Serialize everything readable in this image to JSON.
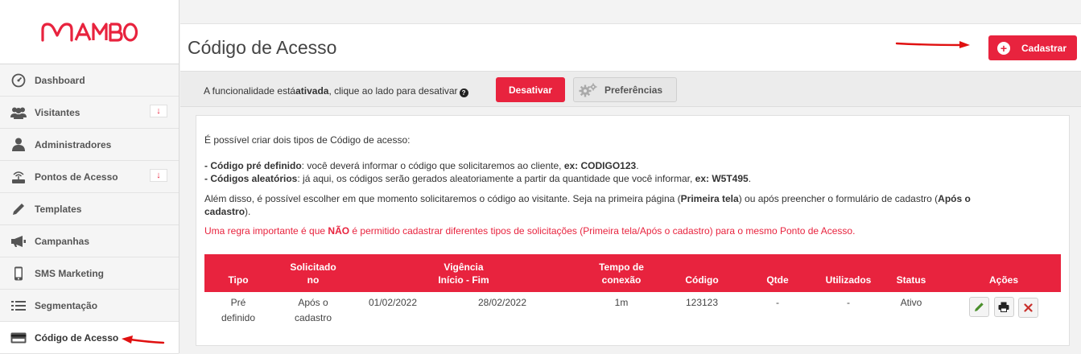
{
  "brand": {
    "logo_text": "MAMBO",
    "accent": "#e8233e"
  },
  "sidebar": {
    "items": [
      {
        "label": "Dashboard",
        "icon": "dashboard-gauge-icon"
      },
      {
        "label": "Visitantes",
        "icon": "users-icon",
        "badge": "↓"
      },
      {
        "label": "Administradores",
        "icon": "user-icon"
      },
      {
        "label": "Pontos de Acesso",
        "icon": "wifi-router-icon",
        "badge": "↓"
      },
      {
        "label": "Templates",
        "icon": "pencil-icon"
      },
      {
        "label": "Campanhas",
        "icon": "megaphone-icon"
      },
      {
        "label": "SMS Marketing",
        "icon": "mobile-phone-icon"
      },
      {
        "label": "Segmentação",
        "icon": "list-icon"
      },
      {
        "label": "Código de Acesso",
        "icon": "credit-card-icon",
        "active": true
      }
    ]
  },
  "header": {
    "title": "Código de Acesso",
    "cadastrar_label": "Cadastrar"
  },
  "funcbar": {
    "text_before": "A funcionalidade está",
    "text_bold": "ativada",
    "text_after": ", clique ao lado para desativar",
    "help": "?",
    "desativar_label": "Desativar",
    "preferencias_label": "Preferências"
  },
  "info": {
    "intro": "É possível criar dois tipos de Código de acesso:",
    "item1_bold": "- Código pré definido",
    "item1_text": ": você deverá informar o código que solicitaremos ao cliente, ",
    "item1_ex": "ex: CODIGO123",
    "item1_end": ".",
    "item2_bold": "- Códigos aleatórios",
    "item2_text": ": já aqui, os códigos serão gerados aleatoriamente a partir da quantidade que você informar, ",
    "item2_ex": "ex: W5T495",
    "item2_end": ".",
    "moment_text1": "Além disso, é possível escolher em que momento solicitaremos o código ao visitante. Seja na primeira página (",
    "moment_bold1": "Primeira tela",
    "moment_text2": ") ou após preencher o formulário de cadastro (",
    "moment_bold2": "Após o",
    "moment_bold3": "cadastro",
    "moment_text3": ").",
    "rule_text1": "Uma regra importante é que ",
    "rule_bold": "NÃO",
    "rule_text2": " é permitido cadastrar diferentes tipos de solicitações (Primeira tela/Após o cadastro) para o mesmo Ponto de Acesso."
  },
  "table": {
    "headers": {
      "tipo": "Tipo",
      "solicitado1": "Solicitado",
      "solicitado2": "no",
      "vigencia1": "Vigência",
      "vigencia2": "Início - Fim",
      "tempo1": "Tempo de",
      "tempo2": "conexão",
      "codigo": "Código",
      "qtde": "Qtde",
      "utilizados": "Utilizados",
      "status": "Status",
      "acoes": "Ações"
    },
    "rows": [
      {
        "tipo1": "Pré",
        "tipo2": "definido",
        "solicitado1": "Após o",
        "solicitado2": "cadastro",
        "inicio": "01/02/2022",
        "fim": "28/02/2022",
        "tempo": "1m",
        "codigo": "123123",
        "qtde": "-",
        "utilizados": "-",
        "status": "Ativo"
      }
    ]
  }
}
